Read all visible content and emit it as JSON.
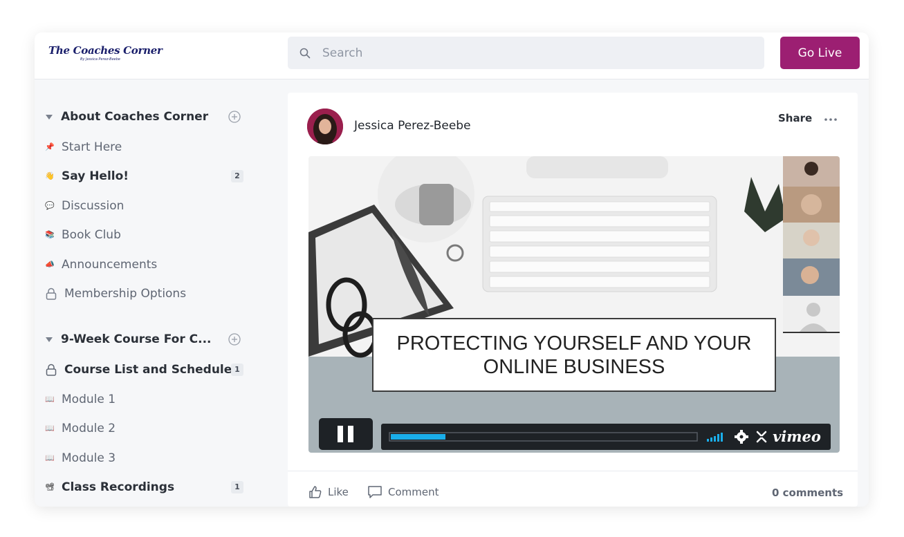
{
  "brand": {
    "title": "The Coaches Corner",
    "subtitle": "By Jessica Perez-Beebe"
  },
  "search": {
    "placeholder": "Search"
  },
  "header": {
    "go_live_label": "Go Live"
  },
  "sidebar": {
    "sections": [
      {
        "title": "About Coaches Corner",
        "items": [
          {
            "icon": "pushpin-icon",
            "label": "Start Here",
            "bold": false
          },
          {
            "icon": "waving-hand-icon",
            "label": "Say Hello!",
            "bold": true,
            "badge": "2"
          },
          {
            "icon": "speech-bubble-icon",
            "label": "Discussion",
            "bold": false
          },
          {
            "icon": "books-icon",
            "label": "Book Club",
            "bold": false
          },
          {
            "icon": "megaphone-icon",
            "label": "Announcements",
            "bold": false
          },
          {
            "icon": "lock-icon",
            "label": "Membership Options",
            "bold": false
          }
        ]
      },
      {
        "title": "9-Week Course For C...",
        "items": [
          {
            "icon": "lock-icon",
            "label": "Course List and Schedule",
            "bold": true,
            "badge": "1"
          },
          {
            "icon": "open-book-icon",
            "label": "Module 1",
            "bold": false
          },
          {
            "icon": "open-book-icon",
            "label": "Module 2",
            "bold": false
          },
          {
            "icon": "open-book-icon",
            "label": "Module 3",
            "bold": false
          },
          {
            "icon": "video-camera-icon",
            "label": "Class Recordings",
            "bold": true,
            "badge": "1"
          }
        ]
      }
    ]
  },
  "post": {
    "author": "Jessica Perez-Beebe",
    "share_label": "Share",
    "video": {
      "title_line1": "PROTECTING YOURSELF AND YOUR",
      "title_line2": "ONLINE BUSINESS",
      "player_brand": "vimeo",
      "progress": 0.18
    },
    "like_label": "Like",
    "comment_label": "Comment",
    "comments_count": "0 comments"
  },
  "colors": {
    "accent": "#9c1f72",
    "brand_navy": "#1a1f6b",
    "progress": "#1aaeea"
  }
}
